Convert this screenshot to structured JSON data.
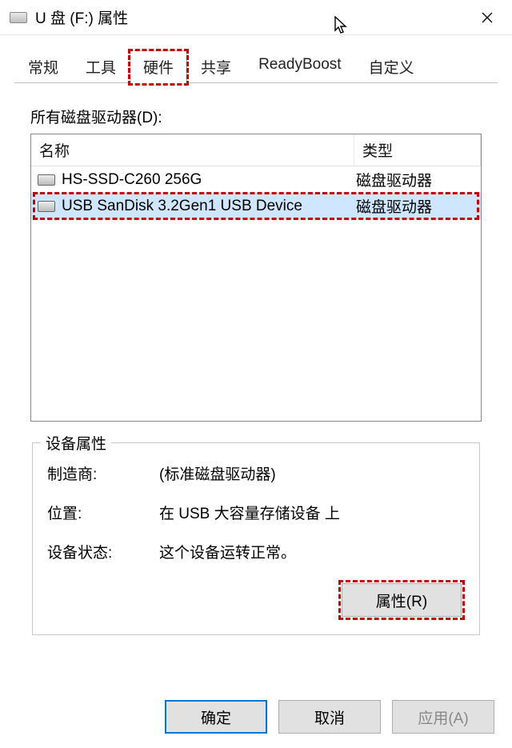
{
  "window": {
    "title": "U 盘 (F:) 属性"
  },
  "tabs": [
    {
      "label": "常规"
    },
    {
      "label": "工具"
    },
    {
      "label": "硬件",
      "active": true,
      "highlight": true
    },
    {
      "label": "共享"
    },
    {
      "label": "ReadyBoost"
    },
    {
      "label": "自定义"
    }
  ],
  "list": {
    "label": "所有磁盘驱动器(D):",
    "columns": {
      "name": "名称",
      "type": "类型"
    },
    "rows": [
      {
        "name": "HS-SSD-C260 256G",
        "type": "磁盘驱动器",
        "selected": false
      },
      {
        "name": "USB  SanDisk 3.2Gen1 USB Device",
        "type": "磁盘驱动器",
        "selected": true
      }
    ]
  },
  "device": {
    "legend": "设备属性",
    "manufacturer_k": "制造商:",
    "manufacturer_v": "(标准磁盘驱动器)",
    "location_k": "位置:",
    "location_v": "在 USB 大容量存储设备 上",
    "status_k": "设备状态:",
    "status_v": "这个设备运转正常。",
    "props_btn": "属性(R)"
  },
  "footer": {
    "ok": "确定",
    "cancel": "取消",
    "apply": "应用(A)"
  }
}
